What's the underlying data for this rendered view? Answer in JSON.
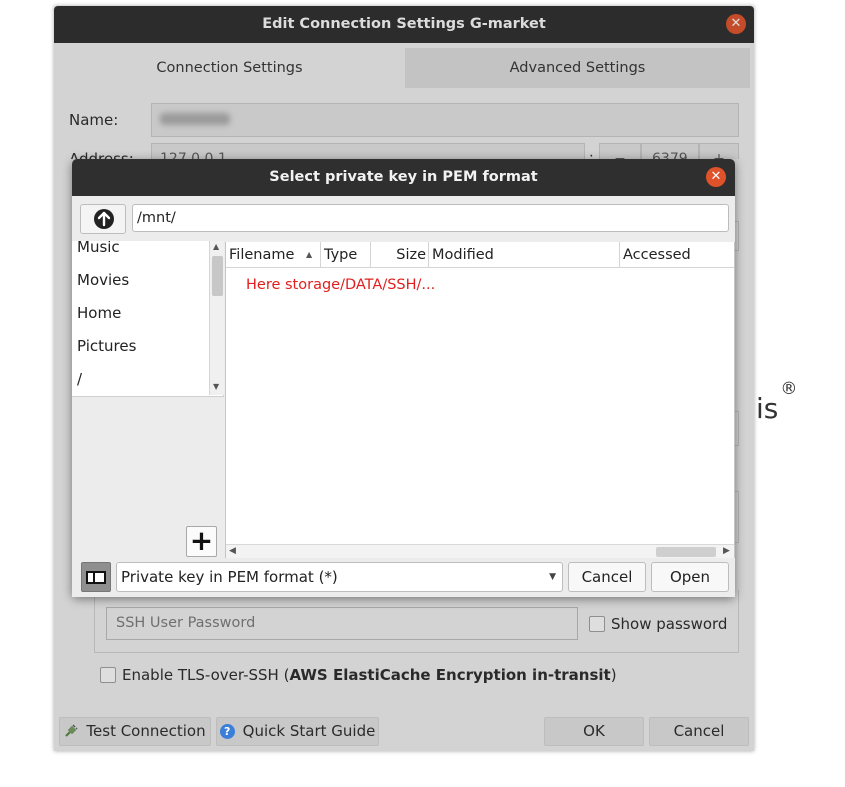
{
  "background_window": {
    "title": "Edit Connection Settings G-market",
    "close_glyph": "✕",
    "tabs": [
      {
        "label": "Connection Settings"
      },
      {
        "label": "Advanced Settings"
      }
    ],
    "name_label": "Name:",
    "address_label": "Address:",
    "address_value": "127.0.0.1",
    "port_value": "6379",
    "port_minus": "−",
    "port_plus": "+",
    "colon": ":",
    "brand_text": "is",
    "registered_mark": "®",
    "ssh_password_placeholder": "SSH User Password",
    "show_password_label": "Show password",
    "tls_label_prefix": "Enable TLS-over-SSH (",
    "tls_label_bold": "AWS ElastiCache Encryption in-transit",
    "tls_label_suffix": ")",
    "test_connection_label": "Test Connection",
    "quick_start_label": "Quick Start Guide",
    "ok_label": "OK",
    "cancel_label": "Cancel",
    "colors": {
      "dim_bg": "#d3d3d3",
      "titlebar": "#2c2c2c",
      "close": "#e0522a"
    }
  },
  "dialog": {
    "title": "Select private key in PEM format",
    "close_glyph": "✕",
    "path": "/mnt/",
    "sidebar_items": [
      {
        "label": "Music"
      },
      {
        "label": "Movies"
      },
      {
        "label": "Home"
      },
      {
        "label": "Pictures"
      },
      {
        "label": "/"
      }
    ],
    "add_place_glyph": "+",
    "columns": [
      {
        "label": "Filename"
      },
      {
        "label": "Type"
      },
      {
        "label": "Size"
      },
      {
        "label": "Modified"
      },
      {
        "label": "Accessed"
      }
    ],
    "placeholder_row": "Here storage/DATA/SSH/...",
    "filter_value": "Private key in PEM format (*)",
    "cancel_label": "Cancel",
    "open_label": "Open",
    "colors": {
      "placeholder_text": "#e0201e",
      "titlebar": "#2f2f2f"
    }
  }
}
